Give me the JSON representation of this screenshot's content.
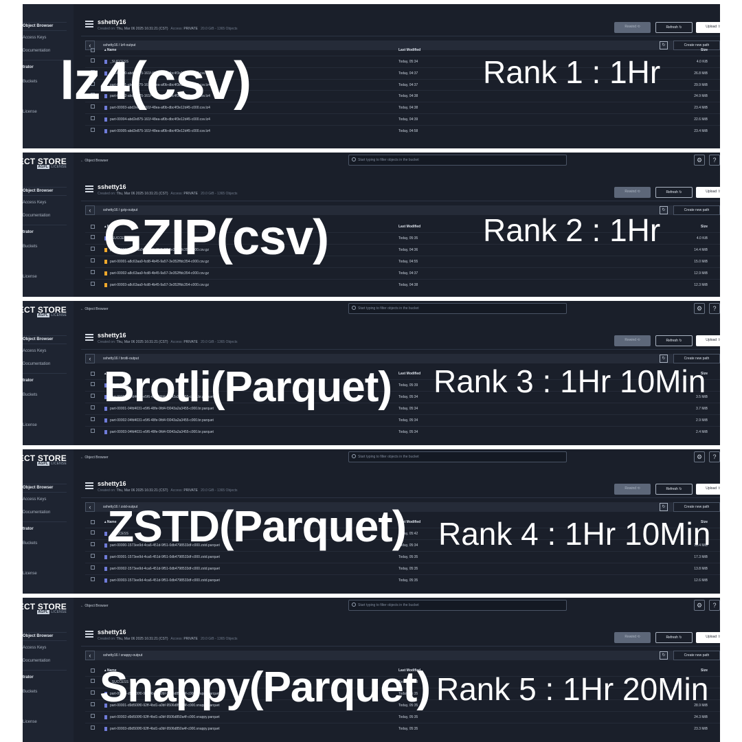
{
  "app": {
    "brand_name": "ECT STORE",
    "license_badge": "AGPL",
    "license_text": "LICENSE",
    "back_label": "← Object Browser",
    "search_placeholder": "Start typing to filter objects in the bucket",
    "sidebar": {
      "object_browser": "Object Browser",
      "access_keys": "Access Keys",
      "documentation": "Documentation",
      "section_admin": "trator",
      "buckets": "Buckets",
      "license": "License"
    },
    "bucket": {
      "name": "sshetty16",
      "created_prefix": "Created on:",
      "created_value": "Thu, Mar 06 2025 16:31:21 (CST)",
      "access_prefix": "Access:",
      "access_value": "PRIVATE",
      "usage": "20.0 GiB - 1365 Objects"
    },
    "buttons": {
      "rewind": "Rewind",
      "refresh": "Refresh",
      "upload": "Upload",
      "create_path": "Create new path"
    },
    "columns": {
      "name": "Name",
      "modified": "Last Modified",
      "size": "Size"
    },
    "icons": [
      "back-arrow-icon",
      "search-icon",
      "settings-icon",
      "help-icon",
      "bucket-icon",
      "chevron-left-icon",
      "rewind-icon",
      "refresh-icon",
      "upload-icon",
      "file-icon"
    ]
  },
  "panels": [
    {
      "label": "lz4(csv)",
      "rank": "Rank 1 : 1Hr",
      "path": "sshetty16 / lz4-output",
      "rows": [
        {
          "name": "_SUCCESS",
          "modified": "Today, 05:34",
          "size": "4.0 KiB"
        },
        {
          "name": "part-00000-abd2e875-161f-48ea-af0b-dbc4f3e12d45-c000.csv.lz4",
          "modified": "Today, 04:37",
          "size": "26.8 MiB"
        },
        {
          "name": "part-00001-abd2e875-161f-48ea-af0b-dbc4f3e12d45-c000.csv.lz4",
          "modified": "Today, 04:37",
          "size": "29.9 MiB"
        },
        {
          "name": "part-00002-abd2e875-161f-48ea-af0b-dbc4f3e12d45-c000.csv.lz4",
          "modified": "Today, 04:38",
          "size": "24.9 MiB"
        },
        {
          "name": "part-00003-abd2e875-161f-48ea-af0b-dbc4f3e12d45-c000.csv.lz4",
          "modified": "Today, 04:38",
          "size": "23.4 MiB"
        },
        {
          "name": "part-00004-abd2e875-161f-48ea-af0b-dbc4f3e12d45-c000.csv.lz4",
          "modified": "Today, 04:39",
          "size": "22.6 MiB"
        },
        {
          "name": "part-00005-abd2e875-161f-48ea-af0b-dbc4f3e12d45-c000.csv.lz4",
          "modified": "Today, 04:58",
          "size": "23.4 MiB"
        }
      ]
    },
    {
      "label": "GZIP(csv)",
      "rank": "Rank 2 : 1Hr",
      "path": "sshetty16 / gzip-output",
      "rows": [
        {
          "name": "_SUCCESS",
          "modified": "Today, 05:35",
          "size": "4.0 KiB"
        },
        {
          "name": "part-00000-a8c63aa9-fcd8-4b45-9a57-3e352ffdc354-c000.csv.gz",
          "modified": "Today, 04:36",
          "size": "14.4 MiB"
        },
        {
          "name": "part-00001-a8c63aa9-fcd8-4b45-9a57-3e352ffdc354-c000.csv.gz",
          "modified": "Today, 04:55",
          "size": "15.0 MiB"
        },
        {
          "name": "part-00002-a8c63aa9-fcd8-4b45-9a57-3e352ffdc354-c000.csv.gz",
          "modified": "Today, 04:37",
          "size": "12.9 MiB"
        },
        {
          "name": "part-00003-a8c63aa9-fcd8-4b45-9a57-3e352ffdc354-c000.csv.gz",
          "modified": "Today, 04:38",
          "size": "12.3 MiB"
        }
      ]
    },
    {
      "label": "Brotli(Parquet)",
      "rank": "Rank 3 : 1Hr 10Min",
      "path": "sshetty16 / brotli-output",
      "rows": [
        {
          "name": "_SUCCESS",
          "modified": "Today, 05:39",
          "size": ""
        },
        {
          "name": "part-00000-04fd4031-e5f6-48fe-9fd4-f3043a2a3455-c000.br.parquet",
          "modified": "Today, 05:34",
          "size": "3.5 MiB"
        },
        {
          "name": "part-00001-04fd4031-e5f6-48fe-9fd4-f3043a2a3455-c000.br.parquet",
          "modified": "Today, 05:34",
          "size": "3.7 MiB"
        },
        {
          "name": "part-00002-04fd4031-e5f6-48fe-9fd4-f3043a2a3455-c000.br.parquet",
          "modified": "Today, 05:34",
          "size": "2.9 MiB"
        },
        {
          "name": "part-00003-04fd4031-e5f6-48fe-9fd4-f3043a2a3455-c000.br.parquet",
          "modified": "Today, 05:34",
          "size": "2.4 MiB"
        }
      ]
    },
    {
      "label": "ZSTD(Parquet)",
      "rank": "Rank 4 : 1Hr 10Min",
      "path": "sshetty16 / zstd-output",
      "rows": [
        {
          "name": "_SUCCESS",
          "modified": "Today, 05:42",
          "size": ""
        },
        {
          "name": "part-00000-1573ee9d-4ca6-451d-9f51-0db4798533df-c000.zstd.parquet",
          "modified": "Today, 05:34",
          "size": "18.4 MiB"
        },
        {
          "name": "part-00001-1573ee9d-4ca6-451d-9f51-0db4798533df-c000.zstd.parquet",
          "modified": "Today, 05:35",
          "size": "17.3 MiB"
        },
        {
          "name": "part-00002-1573ee9d-4ca6-451d-9f51-0db4798533df-c000.zstd.parquet",
          "modified": "Today, 05:35",
          "size": "13.8 MiB"
        },
        {
          "name": "part-00003-1573ee9d-4ca6-451d-9f51-0db4798533df-c000.zstd.parquet",
          "modified": "Today, 05:35",
          "size": "12.6 MiB"
        }
      ]
    },
    {
      "label": "Snappy(Parquet)",
      "rank": "Rank 5 : 1Hr 20Min",
      "path": "sshetty16 / snappy-output",
      "rows": [
        {
          "name": "_SUCCESS",
          "modified": "Today, 05:38",
          "size": ""
        },
        {
          "name": "part-00000-d9d500f0-92ff-4bd1-a0bf-9506d850a4f-c000.snappy.parquet",
          "modified": "Today, 05:35",
          "size": ""
        },
        {
          "name": "part-00001-d9d500f0-92ff-4bd1-a0bf-9506d850a4f-c000.snappy.parquet",
          "modified": "Today, 05:35",
          "size": "28.9 MiB"
        },
        {
          "name": "part-00002-d9d500f0-92ff-4bd1-a0bf-9506d850a4f-c000.snappy.parquet",
          "modified": "Today, 05:35",
          "size": "24.3 MiB"
        },
        {
          "name": "part-00003-d9d500f0-92ff-4bd1-a0bf-9506d850a4f-c000.snappy.parquet",
          "modified": "Today, 05:35",
          "size": "23.3 MiB"
        }
      ]
    }
  ]
}
